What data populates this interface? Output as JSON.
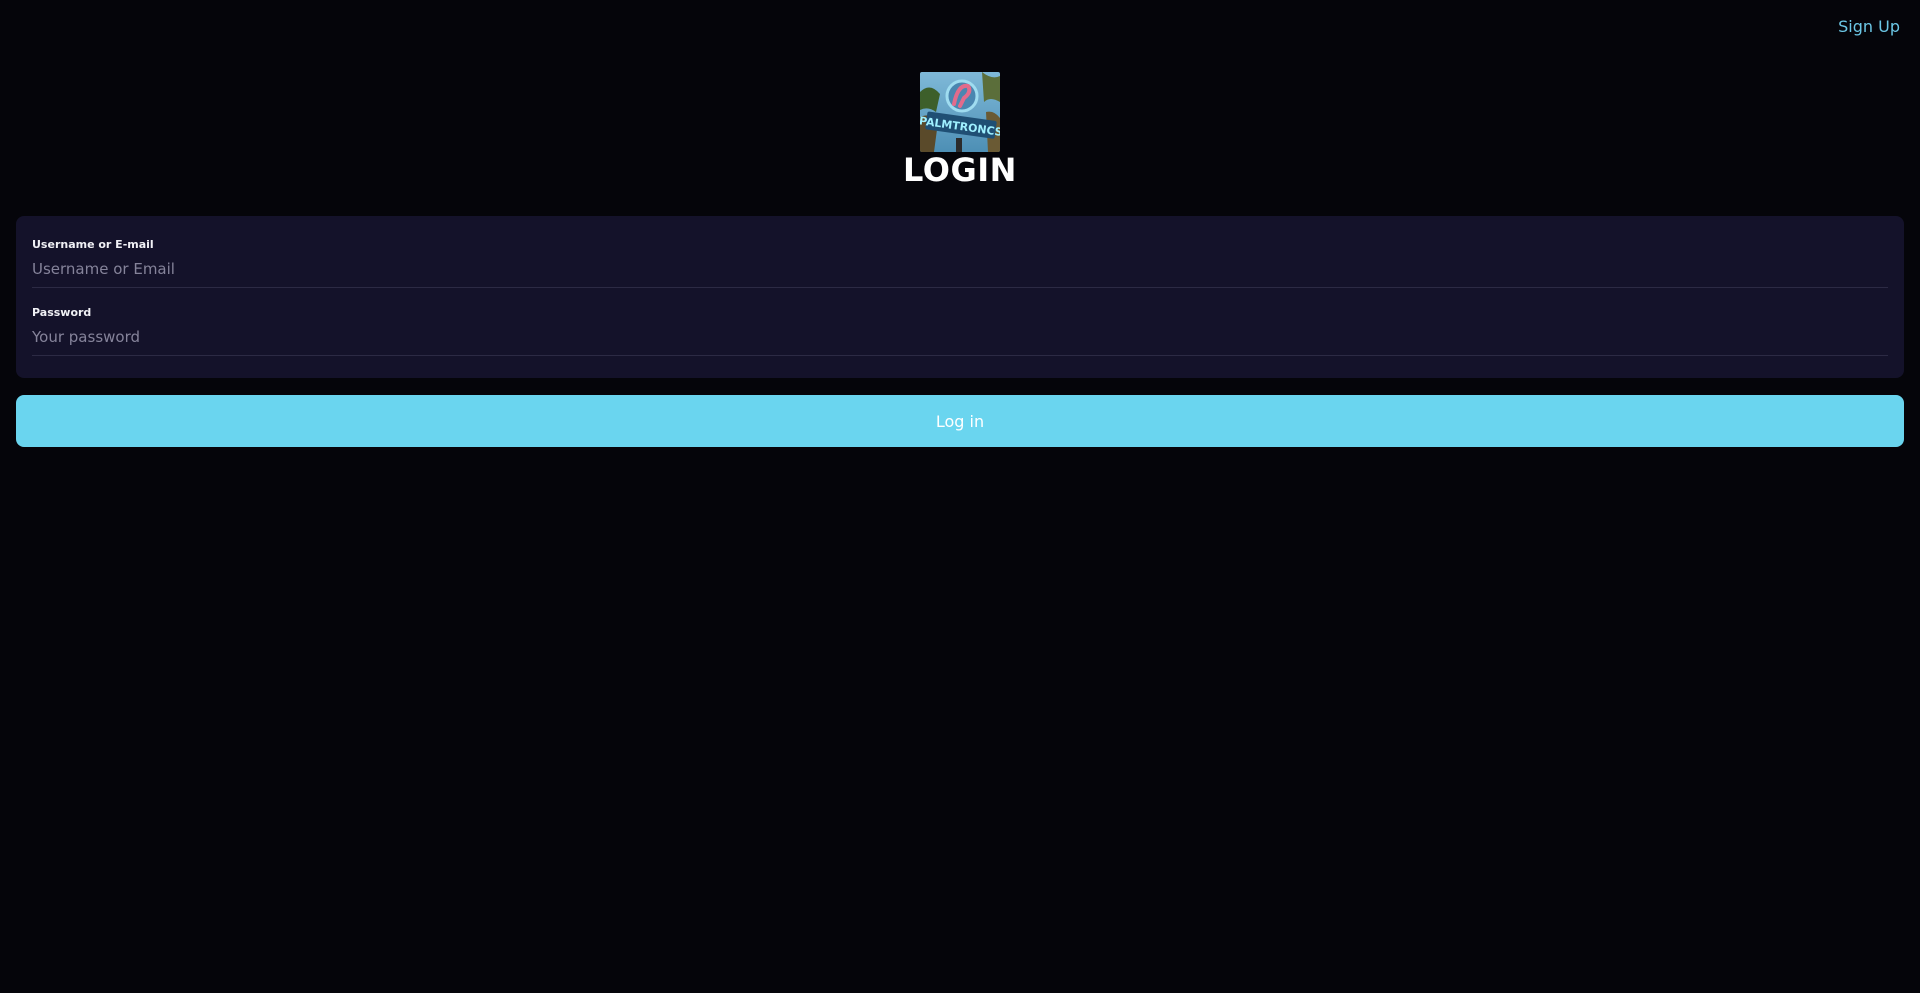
{
  "topbar": {
    "signup_label": "Sign Up"
  },
  "header": {
    "logo_icon": "palmtronics-logo",
    "title": "LOGIN"
  },
  "form": {
    "username": {
      "label": "Username or E-mail",
      "placeholder": "Username or Email",
      "value": ""
    },
    "password": {
      "label": "Password",
      "placeholder": "Your password",
      "value": ""
    }
  },
  "actions": {
    "login_label": "Log in"
  },
  "colors": {
    "background": "#05050a",
    "card": "#14122a",
    "accent": "#6ad5ef",
    "link": "#6cc7e6"
  }
}
